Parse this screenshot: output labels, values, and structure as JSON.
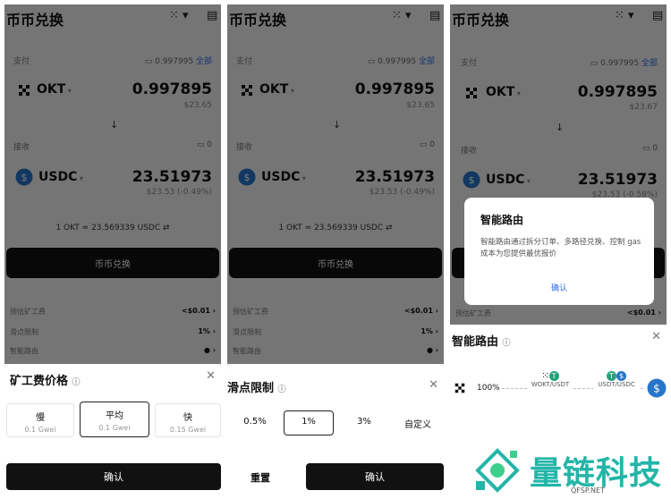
{
  "screen_title": "币币兑换",
  "pay_label": "支付",
  "receive_label": "接收",
  "all_label": "全部",
  "pay_token": "OKT",
  "receive_token": "USDC",
  "panels": [
    {
      "pay_balance": "0.997995",
      "pay_amount": "0.997895",
      "pay_usd": "$23.65",
      "receive_balance": "0",
      "receive_amount": "23.51973",
      "receive_usd": "$23.53 (-0.49%)",
      "rate": "1 OKT ≈ 23.569339 USDC"
    },
    {
      "pay_balance": "0.997995",
      "pay_amount": "0.997895",
      "pay_usd": "$23.65",
      "receive_balance": "0",
      "receive_amount": "23.51973",
      "receive_usd": "$23.53 (-0.49%)",
      "rate": "1 OKT ≈ 23.569339 USDC"
    },
    {
      "pay_balance": "0.997995",
      "pay_amount": "0.997895",
      "pay_usd": "$23.67",
      "receive_balance": "0",
      "receive_amount": "23.51973",
      "receive_usd": "$23.53 (-0.58%)",
      "rate": ""
    }
  ],
  "swap_button": "币币兑换",
  "fee_rows": [
    {
      "label": "预估矿工费",
      "value": "<$0.01"
    },
    {
      "label": "滑点限制",
      "value": "1%"
    },
    {
      "label": "智能路由",
      "value": ""
    }
  ],
  "gas_sheet": {
    "title": "矿工费价格",
    "options": [
      {
        "name": "慢",
        "gwei": "0.1 Gwei"
      },
      {
        "name": "平均",
        "gwei": "0.1 Gwei"
      },
      {
        "name": "快",
        "gwei": "0.15 Gwei"
      }
    ],
    "selected_index": 1,
    "confirm": "确认"
  },
  "slippage_sheet": {
    "title": "滑点限制",
    "options": [
      "0.5%",
      "1%",
      "3%",
      "自定义"
    ],
    "selected_index": 1,
    "reset": "重置",
    "confirm": "确认"
  },
  "routing_dialog": {
    "title": "智能路由",
    "body": "智能路由通过拆分订单、多路径兑换、控制 gas 成本为您提供最优报价",
    "ok": "确认"
  },
  "routing_panel": {
    "title": "智能路由",
    "percent": "100%",
    "hops": [
      "WOKT/USDT",
      "USDT/USDC"
    ]
  },
  "watermark": {
    "text": "量链科技",
    "sub": "QFSP.NET"
  },
  "colors": {
    "accent_blue": "#2c6ee6",
    "usdc_blue": "#2775ca",
    "tether_green": "#26a17b",
    "watermark_teal": "#23b5a8",
    "button_black": "#111111"
  },
  "icons": [
    "close-icon",
    "menu-doc-icon",
    "okt-token-icon",
    "usdc-token-icon",
    "down-arrow-icon",
    "info-icon",
    "chevron-right-icon",
    "refresh-icon",
    "wallet-icon"
  ]
}
